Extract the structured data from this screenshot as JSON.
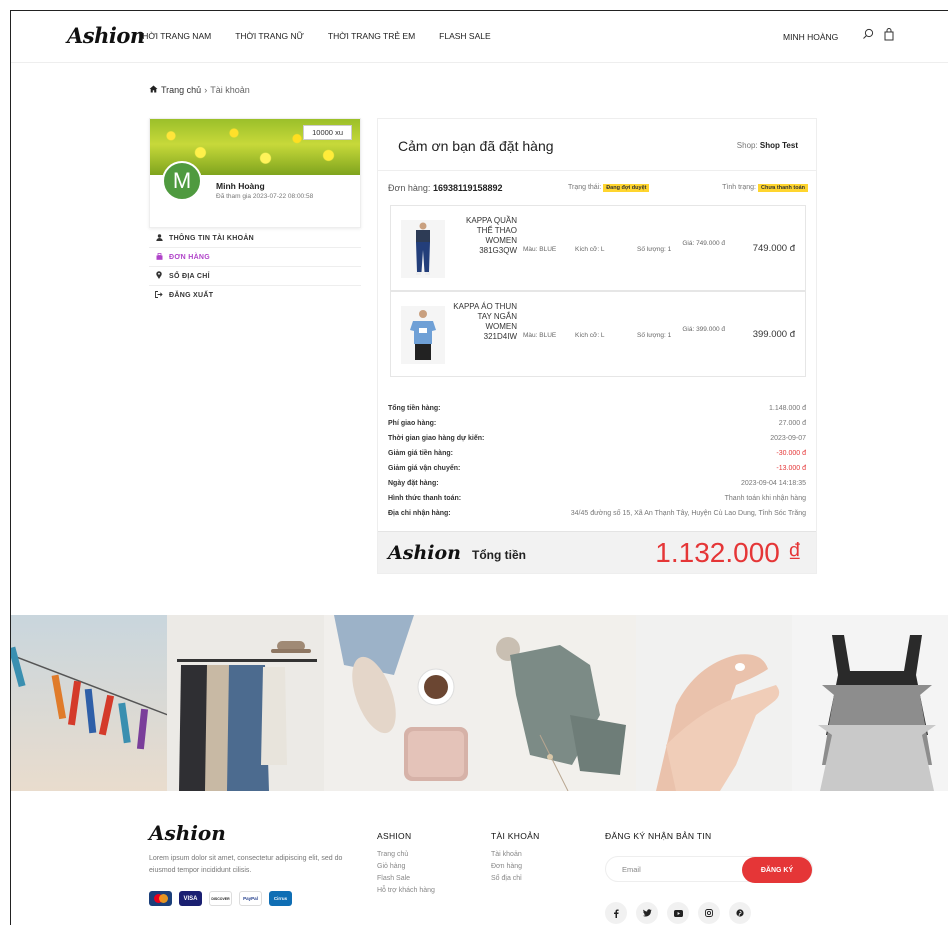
{
  "header": {
    "logo": "Ashion",
    "nav": [
      "THỜI TRANG NAM",
      "THỜI TRANG NỮ",
      "THỜI TRANG TRẺ EM",
      "FLASH SALE"
    ],
    "user": "MINH HOÀNG",
    "icons": [
      "search-icon",
      "cart-icon"
    ]
  },
  "breadcrumb": {
    "home": "Trang chủ",
    "separator": "›",
    "current": "Tài khoản"
  },
  "profile": {
    "points": "10000 xu",
    "avatar_letter": "M",
    "name": "Minh Hoàng",
    "joined": "Đã tham gia 2023-07-22 08:00:58"
  },
  "side_menu": [
    {
      "label": "THÔNG TIN TÀI KHOẢN",
      "icon": "user-icon"
    },
    {
      "label": "ĐƠN HÀNG",
      "icon": "bag-icon",
      "active": true
    },
    {
      "label": "SỔ ĐỊA CHỈ",
      "icon": "map-pin-icon"
    },
    {
      "label": "ĐĂNG XUẤT",
      "icon": "sign-out-icon"
    }
  ],
  "order": {
    "thanks": "Cảm ơn bạn đã đặt hàng",
    "shop_label": "Shop:",
    "shop_name": "Shop Test",
    "number_label": "Đơn hàng:",
    "number": "16938119158892",
    "status_label": "Trạng thái:",
    "status": "Đang đợi duyệt",
    "payment_label": "Tình trạng:",
    "payment": "Chưa thanh toán",
    "items": [
      {
        "name": "KAPPA QUẦN THỂ THAO WOMEN 381G3QW",
        "color": "Màu: BLUE",
        "size": "Kích cỡ: L",
        "qty": "Số lượng: 1",
        "unit_price": "Giá: 749.000 đ",
        "total": "749.000 đ"
      },
      {
        "name": "KAPPA ÁO THUN TAY NGẮN WOMEN 321D4IW",
        "color": "Màu: BLUE",
        "size": "Kích cỡ: L",
        "qty": "Số lượng: 1",
        "unit_price": "Giá: 399.000 đ",
        "total": "399.000 đ"
      }
    ],
    "summary": [
      {
        "label": "Tổng tiền hàng:",
        "value": "1.148.000 đ"
      },
      {
        "label": "Phí giao hàng:",
        "value": "27.000 đ"
      },
      {
        "label": "Thời gian giao hàng dự kiến:",
        "value": "2023-09-07"
      },
      {
        "label": "Giảm giá tiền hàng:",
        "value": "-30.000 đ",
        "red": true
      },
      {
        "label": "Giảm giá vận chuyển:",
        "value": "-13.000 đ",
        "red": true
      },
      {
        "label": "Ngày đặt hàng:",
        "value": "2023-09-04 14:18:35"
      },
      {
        "label": "Hình thức thanh toán:",
        "value": "Thanh toán khi nhận hàng"
      },
      {
        "label": "Địa chỉ nhận hàng:",
        "value": "34/45 đường số 15, Xã An Thạnh Tây, Huyện Cù Lao Dung, Tỉnh Sóc Trăng"
      }
    ],
    "total_logo": "Ashion",
    "total_label": "Tổng tiền",
    "total_value": "1.132.000 ₫"
  },
  "footer": {
    "logo": "Ashion",
    "description": "Lorem ipsum dolor sit amet, consectetur adipiscing elit, sed do eiusmod tempor incididunt cilisis.",
    "payment_cards": [
      "MasterCard",
      "VISA",
      "DISCOVER",
      "PayPal",
      "Cirrus"
    ],
    "col1": {
      "title": "ASHION",
      "links": [
        "Trang chủ",
        "Giỏ hàng",
        "Flash Sale",
        "Hỗ trợ khách hàng"
      ]
    },
    "col2": {
      "title": "TÀI KHOẢN",
      "links": [
        "Tài khoản",
        "Đơn hàng",
        "Sổ địa chỉ"
      ]
    },
    "newsletter": {
      "title": "ĐĂNG KÝ NHẬN BẢN TIN",
      "placeholder": "Email",
      "button": "ĐĂNG KÝ"
    },
    "socials": [
      "facebook-icon",
      "twitter-icon",
      "youtube-icon",
      "instagram-icon",
      "pinterest-icon"
    ]
  },
  "colors": {
    "accent_red": "#e53637",
    "active_purple": "#b043c9",
    "pill_yellow": "#ffd52e"
  }
}
